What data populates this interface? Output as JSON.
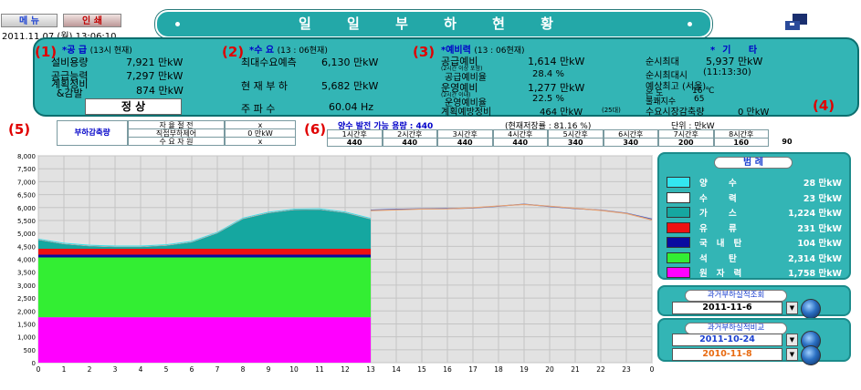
{
  "toolbar": {
    "menu_label": "메 뉴",
    "print_label": "인 쇄"
  },
  "datetime": "2011.11.07 (월) 13:06:10",
  "title": "일 일 부 하 현 황",
  "markers": [
    "(1)",
    "(2)",
    "(3)",
    "(4)",
    "(5)",
    "(6)"
  ],
  "supply": {
    "header": "*공 급",
    "header_sub": "(13시 현재)",
    "rows": [
      {
        "label": "설비용량",
        "value": "7,921 만kW"
      },
      {
        "label": "공급능력",
        "value": "7,297 만kW"
      },
      {
        "label": "계획정비\n&감발",
        "value": "874 만kW"
      }
    ],
    "status": "정 상"
  },
  "demand": {
    "header": "*수 요",
    "header_sub": "(13 : 06현재)",
    "rows": [
      {
        "label": "최대수요예측",
        "value": "6,130 만kW"
      },
      {
        "label": "현 재 부 하",
        "value": "5,682 만kW"
      },
      {
        "label": "주 파 수",
        "value": "60.04 Hz"
      }
    ]
  },
  "reserve": {
    "header": "*예비력",
    "header_sub": "(13 : 06현재)",
    "supply_reserve_label": "공급예비",
    "supply_reserve_note": "(2시간 이상 포함)",
    "supply_reserve_value": "1,614 만kW",
    "supply_rate_label": "공급예비율",
    "supply_rate_value": "28.4 %",
    "operating_reserve_label": "운영예비",
    "operating_reserve_note": "(2시간 이내)",
    "operating_reserve_value": "1,277 만kW",
    "operating_rate_label": "운영예비율",
    "operating_rate_value": "22.5 %",
    "planned_label": "계획예방정비",
    "planned_value": "464 만kW",
    "planned_note": "(25대)"
  },
  "etc": {
    "header": "*기 타",
    "instant_max_label": "순시최대",
    "instant_max_value": "5,937 만kW",
    "instant_max_time_label": "순시최대시",
    "instant_max_time_value": "(11:13:30)",
    "forecast_label": "예상최고 (서울)",
    "temp_label": "온 도",
    "temp_value": "16 ℃",
    "discomfort_label": "불쾌지수",
    "discomfort_value": "65",
    "demand_cut_label": "수요시장감축량",
    "demand_cut_value": "0 만kW"
  },
  "load_reduction": {
    "label": "부하감축량",
    "rows": [
      {
        "label": "자 율 절 전",
        "value": "x"
      },
      {
        "label": "직접부하제어",
        "value": "0 만kW"
      },
      {
        "label": "수 요 자 원",
        "value": "x"
      }
    ]
  },
  "pumped": {
    "title": "양수 발전 가능 용량 : 440",
    "stored": "(현재저장률 : 81.16 %)",
    "unit": "단위 : 만kW",
    "headers": [
      "1시간후",
      "2시간후",
      "3시간후",
      "4시간후",
      "5시간후",
      "6시간후",
      "7시간후",
      "8시간후"
    ],
    "values": [
      "440",
      "440",
      "440",
      "440",
      "340",
      "340",
      "200",
      "160",
      "90"
    ]
  },
  "legend": {
    "title": "범 례",
    "items": [
      {
        "name": "양 수",
        "value": "28 만kW",
        "color": "#33e6f0"
      },
      {
        "name": "수 력",
        "value": "23 만kW",
        "color": "#ffffff"
      },
      {
        "name": "가 스",
        "value": "1,224 만kW",
        "color": "#15a7a0"
      },
      {
        "name": "유 류",
        "value": "231 만kW",
        "color": "#ee1111"
      },
      {
        "name": "국내탄",
        "value": "104 만kW",
        "color": "#0a0aa0"
      },
      {
        "name": "석 탄",
        "value": "2,314 만kW",
        "color": "#33ee33"
      },
      {
        "name": "원자력",
        "value": "1,758 만kW",
        "color": "#ff00ff"
      }
    ]
  },
  "history_lookup": {
    "title": "과거부하실적조회",
    "date": "2011-11-6"
  },
  "history_compare": {
    "title": "과거부하실적비교",
    "date1": "2011-10-24",
    "date2": "2010-11-8",
    "date1_color": "#1a3fd0",
    "date2_color": "#e86a10"
  },
  "chart_data": {
    "type": "area",
    "x_ticks": [
      "0",
      "1",
      "2",
      "3",
      "4",
      "5",
      "6",
      "7",
      "8",
      "9",
      "10",
      "11",
      "12",
      "13",
      "14",
      "15",
      "16",
      "17",
      "18",
      "19",
      "20",
      "21",
      "22",
      "23",
      "0"
    ],
    "y_ticks": [
      "0",
      "500",
      "1,000",
      "1,500",
      "2,000",
      "2,500",
      "3,000",
      "3,500",
      "4,000",
      "4,500",
      "5,000",
      "5,500",
      "6,000",
      "6,500",
      "7,000",
      "7,500",
      "8,000"
    ],
    "ylim": [
      0,
      8000
    ],
    "xlim": [
      0,
      24
    ],
    "actual_hours_end": 13,
    "stack_series": [
      {
        "name": "원자력",
        "color": "#ff00ff",
        "values": [
          1758,
          1758,
          1758,
          1758,
          1758,
          1758,
          1758,
          1758,
          1758,
          1758,
          1758,
          1758,
          1758,
          1758
        ]
      },
      {
        "name": "석탄",
        "color": "#33ee33",
        "values": [
          2314,
          2314,
          2314,
          2314,
          2314,
          2314,
          2314,
          2314,
          2314,
          2314,
          2314,
          2314,
          2314,
          2314
        ]
      },
      {
        "name": "국내탄",
        "color": "#0a0aa0",
        "values": [
          104,
          104,
          104,
          104,
          104,
          104,
          104,
          104,
          104,
          104,
          104,
          104,
          104,
          104
        ]
      },
      {
        "name": "유류",
        "color": "#ee1111",
        "values": [
          231,
          231,
          231,
          231,
          231,
          231,
          231,
          231,
          231,
          231,
          231,
          231,
          231,
          231
        ]
      },
      {
        "name": "가스",
        "color": "#15a7a0",
        "values": [
          340,
          180,
          100,
          70,
          70,
          120,
          250,
          600,
          1150,
          1380,
          1500,
          1510,
          1390,
          1140
        ]
      },
      {
        "name": "수력",
        "color": "#ffffff",
        "values": [
          23,
          23,
          23,
          23,
          23,
          23,
          23,
          23,
          23,
          23,
          23,
          23,
          23,
          23
        ]
      },
      {
        "name": "양수",
        "color": "#33e6f0",
        "values": [
          28,
          28,
          28,
          28,
          28,
          28,
          28,
          28,
          28,
          28,
          28,
          28,
          28,
          28
        ]
      }
    ],
    "forecast_series": [
      {
        "name": "예측",
        "color": "#3355cc",
        "x": [
          13,
          14,
          15,
          16,
          17,
          18,
          19,
          20,
          21,
          22,
          23,
          24
        ],
        "values": [
          5900,
          5930,
          5950,
          5960,
          5980,
          6050,
          6130,
          6040,
          5960,
          5900,
          5780,
          5550
        ]
      },
      {
        "name": "비교",
        "color": "#e6a070",
        "x": [
          13,
          14,
          15,
          16,
          17,
          18,
          19,
          20,
          21,
          22,
          23,
          24
        ],
        "values": [
          5880,
          5910,
          5940,
          5950,
          5990,
          6060,
          6120,
          6050,
          5970,
          5890,
          5770,
          5520
        ]
      }
    ]
  }
}
